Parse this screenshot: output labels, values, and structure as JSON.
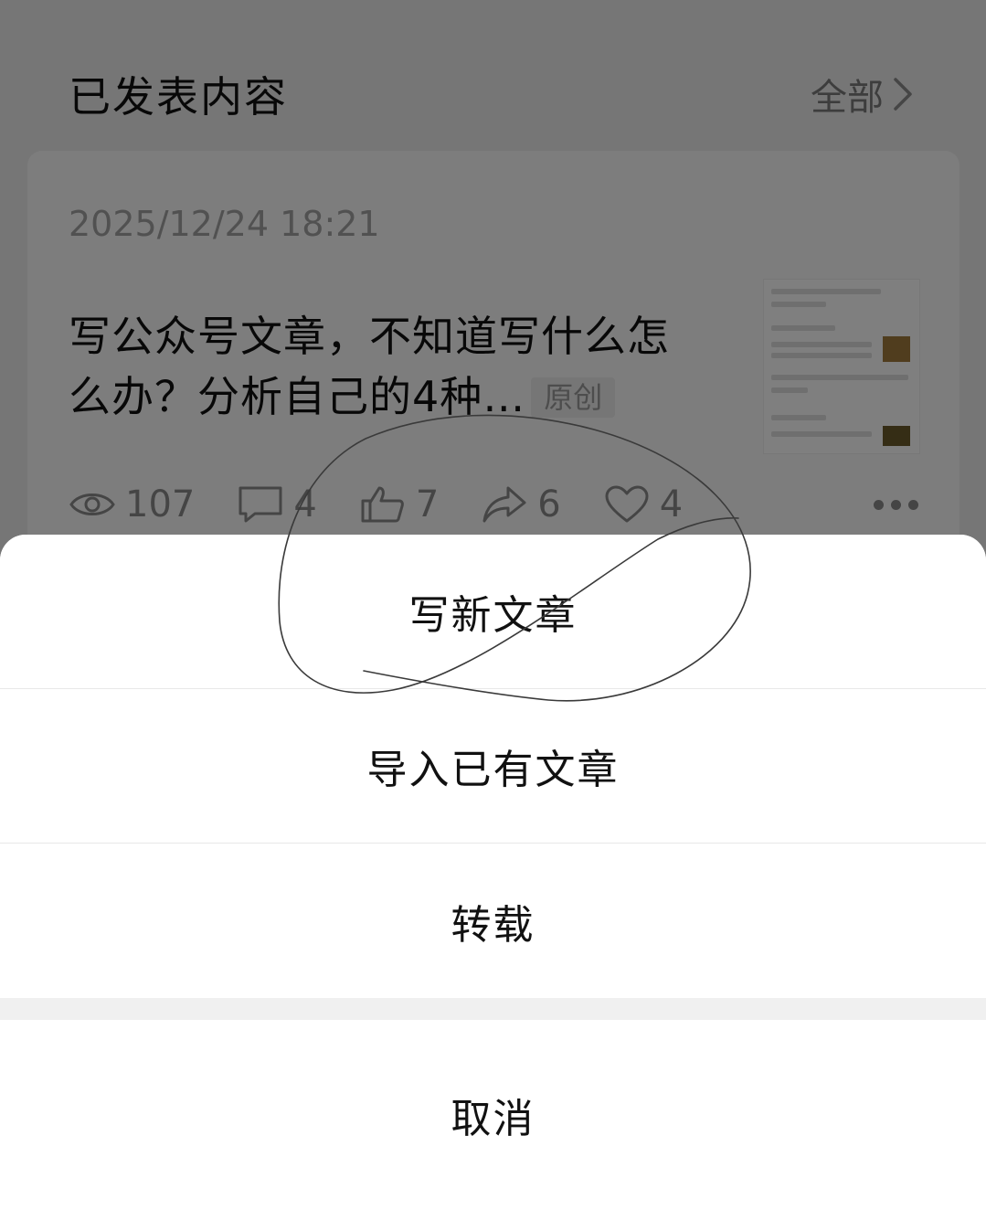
{
  "section": {
    "title": "已发表内容",
    "all_label": "全部"
  },
  "article": {
    "date": "2025/12/24 18:21",
    "title": "写公众号文章，不知道写什么怎么办？分析自己的4种…",
    "badge": "原创",
    "stats": {
      "views": "107",
      "comments": "4",
      "likes": "7",
      "shares": "6",
      "favorites": "4"
    }
  },
  "action_sheet": {
    "items": [
      "写新文章",
      "导入已有文章",
      "转载"
    ],
    "cancel": "取消"
  },
  "colors": {
    "overlay": "#000000",
    "sheet_bg": "#ffffff",
    "muted_text": "#8a8a8a"
  }
}
